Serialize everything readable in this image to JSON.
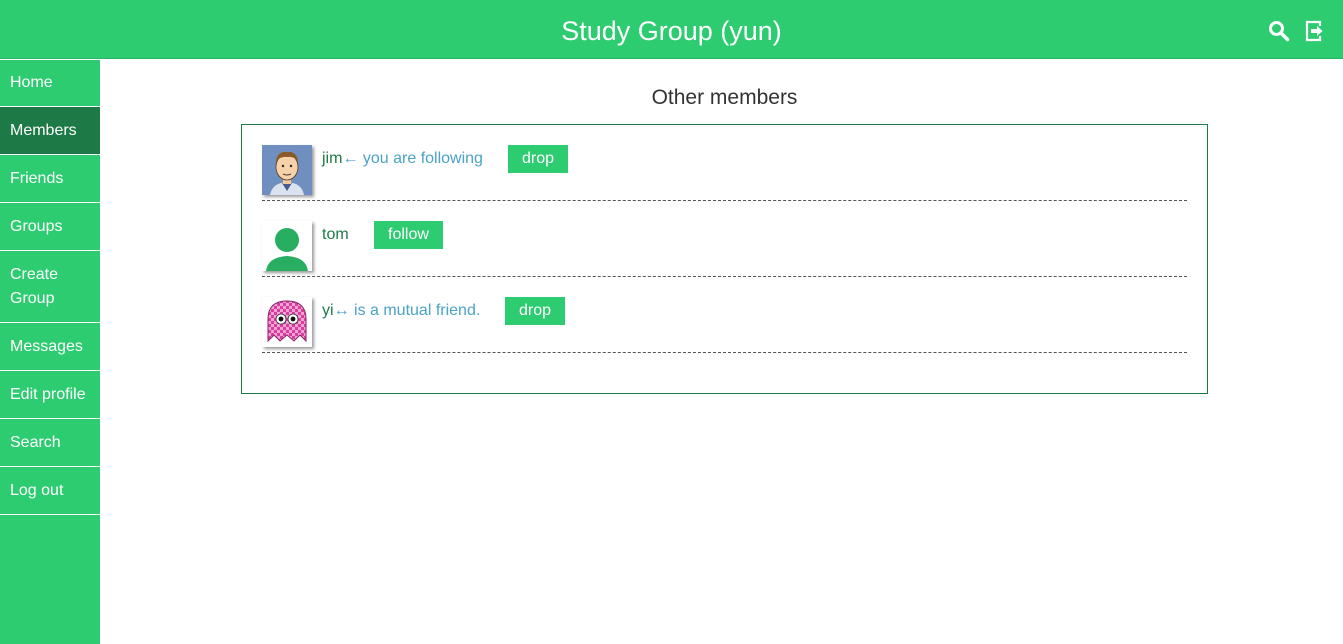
{
  "header": {
    "title": "Study Group (yun)",
    "icons": [
      "search-icon",
      "logout-icon"
    ]
  },
  "sidebar": {
    "items": [
      {
        "label": "Home",
        "active": false
      },
      {
        "label": "Members",
        "active": true
      },
      {
        "label": "Friends",
        "active": false
      },
      {
        "label": "Groups",
        "active": false
      },
      {
        "label": "Create Group",
        "active": false
      },
      {
        "label": "Messages",
        "active": false
      },
      {
        "label": "Edit profile",
        "active": false
      },
      {
        "label": "Search",
        "active": false
      },
      {
        "label": "Log out",
        "active": false
      }
    ]
  },
  "main": {
    "title": "Other members",
    "members": [
      {
        "name": "jim",
        "status": "← you are following",
        "action": "drop",
        "avatar": "cartoon-man-avatar"
      },
      {
        "name": "tom",
        "status": "",
        "action": "follow",
        "avatar": "default-person-avatar"
      },
      {
        "name": "yi",
        "status": "↔ is a mutual friend.",
        "action": "drop",
        "avatar": "pink-ghost-avatar"
      }
    ]
  },
  "colors": {
    "brand": "#2ecc71",
    "active_nav": "#1d7a47",
    "name_text": "#1d7a47",
    "status_text": "#4aa3c8"
  }
}
